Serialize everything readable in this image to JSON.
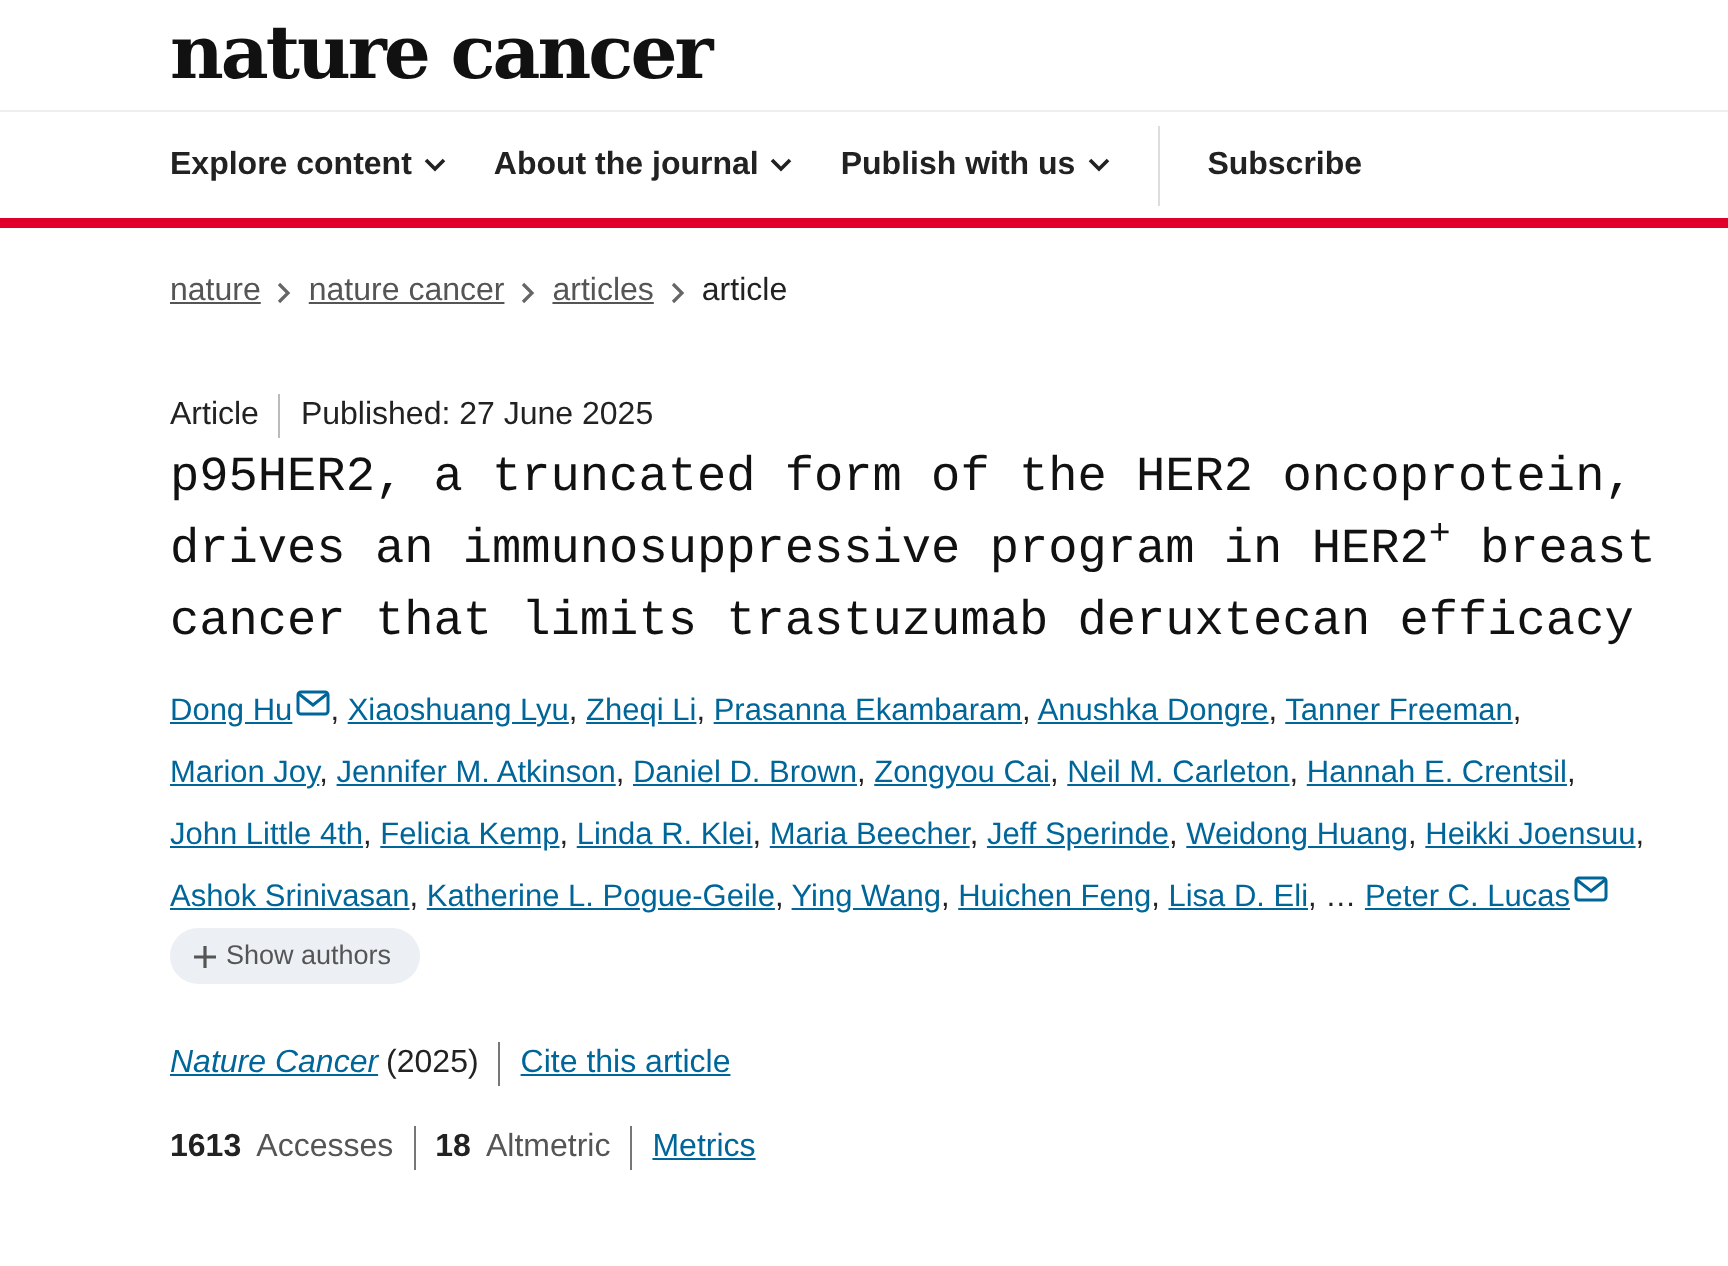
{
  "logo": "nature cancer",
  "nav": [
    {
      "label": "Explore content",
      "dropdown": true
    },
    {
      "label": "About the journal",
      "dropdown": true
    },
    {
      "label": "Publish with us",
      "dropdown": true
    },
    {
      "label": "Subscribe",
      "dropdown": false
    }
  ],
  "breadcrumb": [
    {
      "label": "nature",
      "link": true
    },
    {
      "label": "nature cancer",
      "link": true
    },
    {
      "label": "articles",
      "link": true
    },
    {
      "label": "article",
      "link": false
    }
  ],
  "article": {
    "type": "Article",
    "published": "Published: 27 June 2025",
    "title": "p95HER2, a truncated form of the HER2 oncoprotein, drives an immunosuppressive program in HER2$^{+}$ breast cancer that limits trastuzumab deruxtecan efficacy",
    "authors_separator": ",",
    "authors": [
      {
        "kind": "author",
        "name": "Dong Hu",
        "email": true
      },
      {
        "kind": "author",
        "name": "Xiaoshuang Lyu",
        "email": false
      },
      {
        "kind": "author",
        "name": "Zheqi Li",
        "email": false
      },
      {
        "kind": "author",
        "name": "Prasanna Ekambaram",
        "email": false
      },
      {
        "kind": "author",
        "name": "Anushka Dongre",
        "email": false
      },
      {
        "kind": "author",
        "name": "Tanner Freeman",
        "email": false
      },
      {
        "kind": "author",
        "name": "Marion Joy",
        "email": false
      },
      {
        "kind": "author",
        "name": "Jennifer M. Atkinson",
        "email": false
      },
      {
        "kind": "author",
        "name": "Daniel D. Brown",
        "email": false
      },
      {
        "kind": "author",
        "name": "Zongyou Cai",
        "email": false
      },
      {
        "kind": "author",
        "name": "Neil M. Carleton",
        "email": false
      },
      {
        "kind": "author",
        "name": "Hannah E. Crentsil",
        "email": false
      },
      {
        "kind": "author",
        "name": "John Little 4th",
        "email": false
      },
      {
        "kind": "author",
        "name": "Felicia Kemp",
        "email": false
      },
      {
        "kind": "author",
        "name": "Linda R. Klei",
        "email": false
      },
      {
        "kind": "author",
        "name": "Maria Beecher",
        "email": false
      },
      {
        "kind": "author",
        "name": "Jeff Sperinde",
        "email": false
      },
      {
        "kind": "author",
        "name": "Weidong Huang",
        "email": false
      },
      {
        "kind": "author",
        "name": "Heikki Joensuu",
        "email": false
      },
      {
        "kind": "author",
        "name": "Ashok Srinivasan",
        "email": false
      },
      {
        "kind": "author",
        "name": "Katherine L. Pogue-Geile",
        "email": false
      },
      {
        "kind": "author",
        "name": "Ying Wang",
        "email": false
      },
      {
        "kind": "author",
        "name": "Huichen Feng",
        "email": false
      },
      {
        "kind": "author",
        "name": "Lisa D. Eli",
        "email": false
      },
      {
        "kind": "ellipsis",
        "name": "…",
        "email": false
      },
      {
        "kind": "author",
        "name": "Peter C. Lucas",
        "email": true
      }
    ],
    "show_authors": "Show authors",
    "journal": "Nature Cancer",
    "year": "(2025)",
    "cite": "Cite this article",
    "metrics": [
      {
        "kind": "count",
        "text": "**1613** Accesses"
      },
      {
        "kind": "count",
        "text": "**18** Altmetric"
      },
      {
        "kind": "link",
        "label": "Metrics"
      }
    ]
  }
}
